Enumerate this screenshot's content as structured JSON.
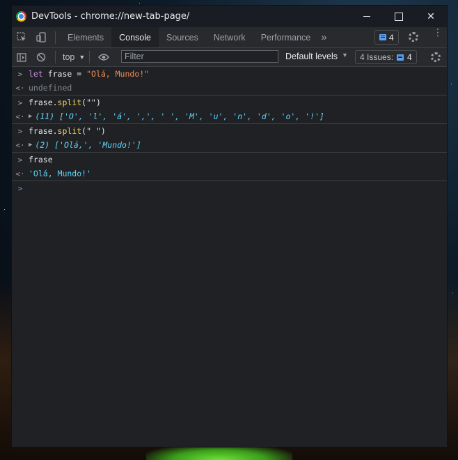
{
  "window": {
    "title": "DevTools - chrome://new-tab-page/"
  },
  "tabs": [
    {
      "label": "Elements"
    },
    {
      "label": "Console",
      "active": true
    },
    {
      "label": "Sources"
    },
    {
      "label": "Network"
    },
    {
      "label": "Performance"
    }
  ],
  "tabbar": {
    "more_icon": "»",
    "messages_count": "4"
  },
  "toolbar": {
    "context": "top",
    "filter_placeholder": "Filter",
    "levels": "Default levels",
    "issues_label": "4 Issues:",
    "issues_count": "4"
  },
  "console": {
    "entries": [
      {
        "input": {
          "kw": "let",
          "rest": " frase = ",
          "str": "\"Olá, Mundo!\""
        },
        "output": "undefined"
      },
      {
        "input": {
          "obj": "frase.",
          "fn": "split",
          "args": "(\"\")"
        },
        "output": "(11) ['O', 'l', 'á', ',', ' ', 'M', 'u', 'n', 'd', 'o', '!']"
      },
      {
        "input": {
          "obj": "frase.",
          "fn": "split",
          "args": "(\" \")"
        },
        "output": "(2) ['Olá,', 'Mundo!']"
      },
      {
        "input": {
          "obj": "frase"
        },
        "output": "'Olá, Mundo!'"
      }
    ]
  },
  "colors": {
    "panel_bg": "#202124",
    "toolbar_bg": "#292a2d",
    "string": "#f28b54",
    "keyword": "#c792ea",
    "function": "#f4d35e",
    "array_item": "#5cd5fb",
    "accent": "#5aa2f6"
  }
}
